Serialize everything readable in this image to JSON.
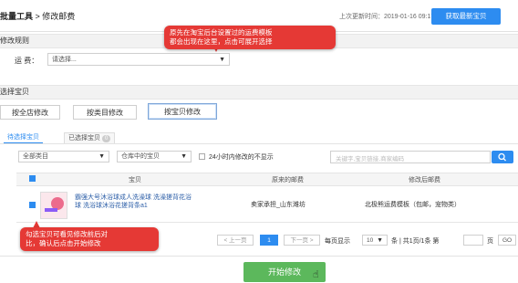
{
  "header": {
    "breadcrumb_part1": "批量工具",
    "breadcrumb_sep": " > ",
    "breadcrumb_part2": "修改邮费",
    "sync_label": "上次更新时间：",
    "sync_time": "2019-01-16 09:17",
    "fetch_button": "获取最新宝贝"
  },
  "tip_top": {
    "line1": "原先在淘宝后台设置过的运费模板",
    "line2": "都会出现在这里，点击可展开选择"
  },
  "rule_section": {
    "title": "修改规则",
    "freight_label": "运 费：",
    "freight_placeholder": "请选择..."
  },
  "select_section": {
    "title": "选择宝贝",
    "modes": [
      "按全店修改",
      "按类目修改",
      "按宝贝修改"
    ],
    "active_mode_index": 2
  },
  "tabs": {
    "pending": "待选择宝贝",
    "selected": "已选择宝贝",
    "selected_count": "0"
  },
  "filters": {
    "category": "全部类目",
    "status": "仓库中的宝贝",
    "recent_label": "24小时内修改的不显示",
    "search_placeholder": "关键字,宝贝链接,商家编码"
  },
  "table": {
    "headers": {
      "item": "宝贝",
      "orig_fee": "原来的邮费",
      "new_fee": "修改后邮费"
    },
    "rows": [
      {
        "checked": true,
        "title_line1": "霸强大号沐浴球成人洗澡球 洗澡搓背花浴",
        "title_line2": "球 洗浴球沐浴花搓背条a1",
        "orig_fee": "卖家承担_山东潍坊",
        "new_fee": "北极熊运费模板（包邮，宠物类）"
      }
    ]
  },
  "tip_bottom": {
    "line1": "勾选宝贝可看见修改前后对",
    "line2": "比，确认后点击开始修改"
  },
  "pagination": {
    "prev": "< 上一页",
    "current_page": "1",
    "next": "下一页 >",
    "per_page_label": "每页显示",
    "per_page_value": "10",
    "summary": "条 | 共1页/1条 第",
    "page_suffix": "页",
    "go": "GO"
  },
  "start_button": "开始修改",
  "colors": {
    "accent": "#2d8cf0",
    "tip_red": "#e53935",
    "start_green": "#5cb85c"
  }
}
